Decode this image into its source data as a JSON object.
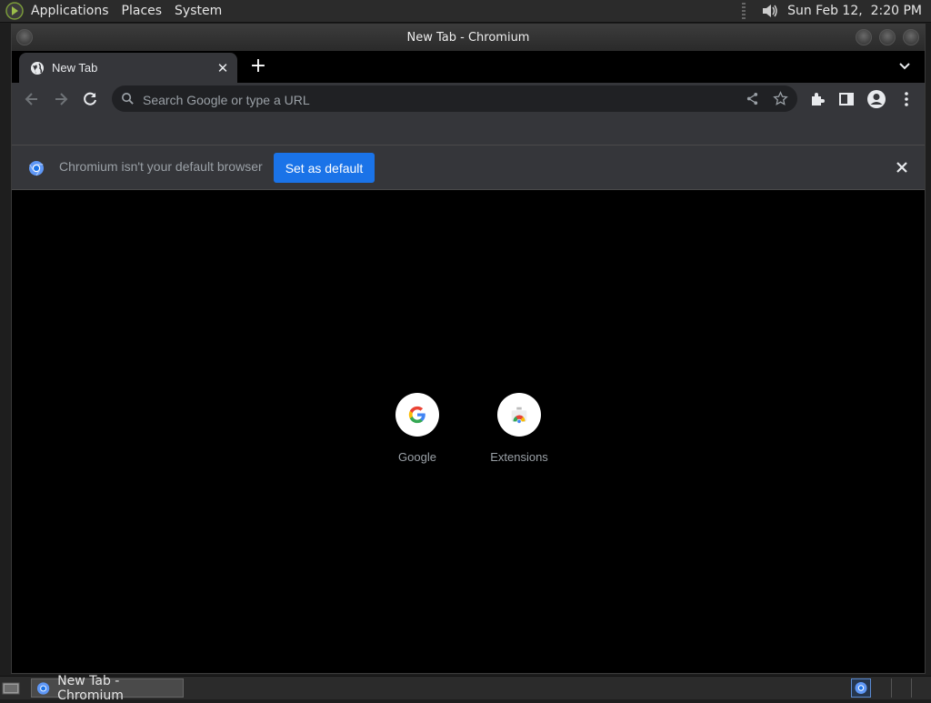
{
  "panel": {
    "menus": [
      "Applications",
      "Places",
      "System"
    ],
    "clock": "Sun Feb 12,  2:20 PM"
  },
  "window": {
    "title": "New Tab - Chromium"
  },
  "tab": {
    "title": "New Tab",
    "close_symbol": "✕",
    "new_tab_symbol": "+"
  },
  "omnibox": {
    "placeholder": "Search Google or type a URL",
    "value": ""
  },
  "infobar": {
    "message": "Chromium isn't your default browser",
    "button_label": "Set as default"
  },
  "shortcuts": [
    {
      "label": "Google",
      "icon": "google-g-icon"
    },
    {
      "label": "Extensions",
      "icon": "chrome-web-store-icon"
    }
  ],
  "taskbar": {
    "task_label": "New Tab - Chromium"
  },
  "colors": {
    "accent": "#1a73e8",
    "toolbar": "#35363a",
    "page_bg": "#000000"
  }
}
